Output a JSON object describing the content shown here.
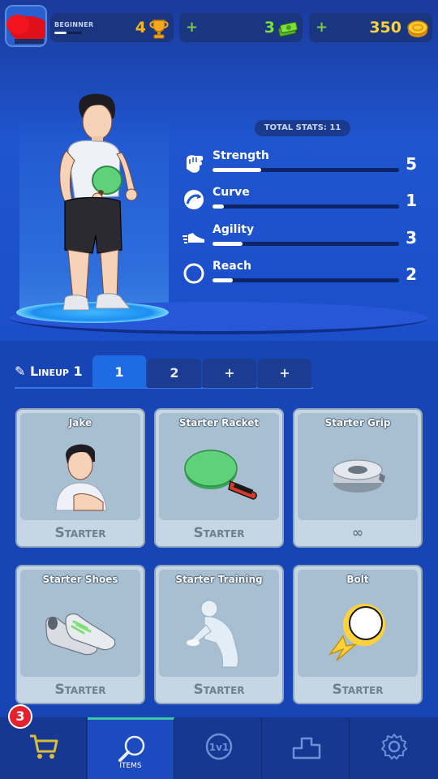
{
  "header": {
    "rank_label": "BEGINNER",
    "trophies": "4",
    "cash": "3",
    "coins": "350",
    "plus_symbol": "+",
    "icons": [
      "trophy-icon",
      "cash-icon",
      "coin-icon"
    ]
  },
  "stats": {
    "total_label": "TOTAL STATS: 11",
    "items": [
      {
        "name": "Strength",
        "value": "5",
        "fraction": 0.26,
        "icon": "fist-icon"
      },
      {
        "name": "Curve",
        "value": "1",
        "fraction": 0.06,
        "icon": "curve-icon"
      },
      {
        "name": "Agility",
        "value": "3",
        "fraction": 0.16,
        "icon": "shoe-icon"
      },
      {
        "name": "Reach",
        "value": "2",
        "fraction": 0.11,
        "icon": "ring-icon"
      }
    ]
  },
  "lineup": {
    "label": "Lineup 1",
    "tabs": [
      "1",
      "2",
      "+",
      "+"
    ],
    "active_tab": 0
  },
  "cards": [
    {
      "title": "Jake",
      "footer": "Starter",
      "art": "character-portrait"
    },
    {
      "title": "Starter Racket",
      "footer": "Starter",
      "art": "racket-icon"
    },
    {
      "title": "Starter Grip",
      "footer": "∞",
      "art": "grip-icon"
    },
    {
      "title": "Starter Shoes",
      "footer": "Starter",
      "art": "shoes-icon"
    },
    {
      "title": "Starter Training",
      "footer": "Starter",
      "art": "training-pose"
    },
    {
      "title": "Bolt",
      "footer": "Starter",
      "art": "bolt-ball-icon"
    }
  ],
  "nav": {
    "items": [
      {
        "name": "shop",
        "label": "",
        "icon": "cart-icon"
      },
      {
        "name": "items",
        "label": "ITEMS",
        "icon": "paddle-icon"
      },
      {
        "name": "1v1",
        "label": "",
        "icon": "versus-icon"
      },
      {
        "name": "leaderboard",
        "label": "",
        "icon": "podium-icon"
      },
      {
        "name": "settings",
        "label": "",
        "icon": "gear-icon"
      }
    ],
    "badge_count": "3"
  },
  "colors": {
    "accent": "#1f6be4",
    "trophy": "#f4b523",
    "cash": "#7be03c",
    "coin": "#ffd23a",
    "badge": "#e3222e"
  }
}
